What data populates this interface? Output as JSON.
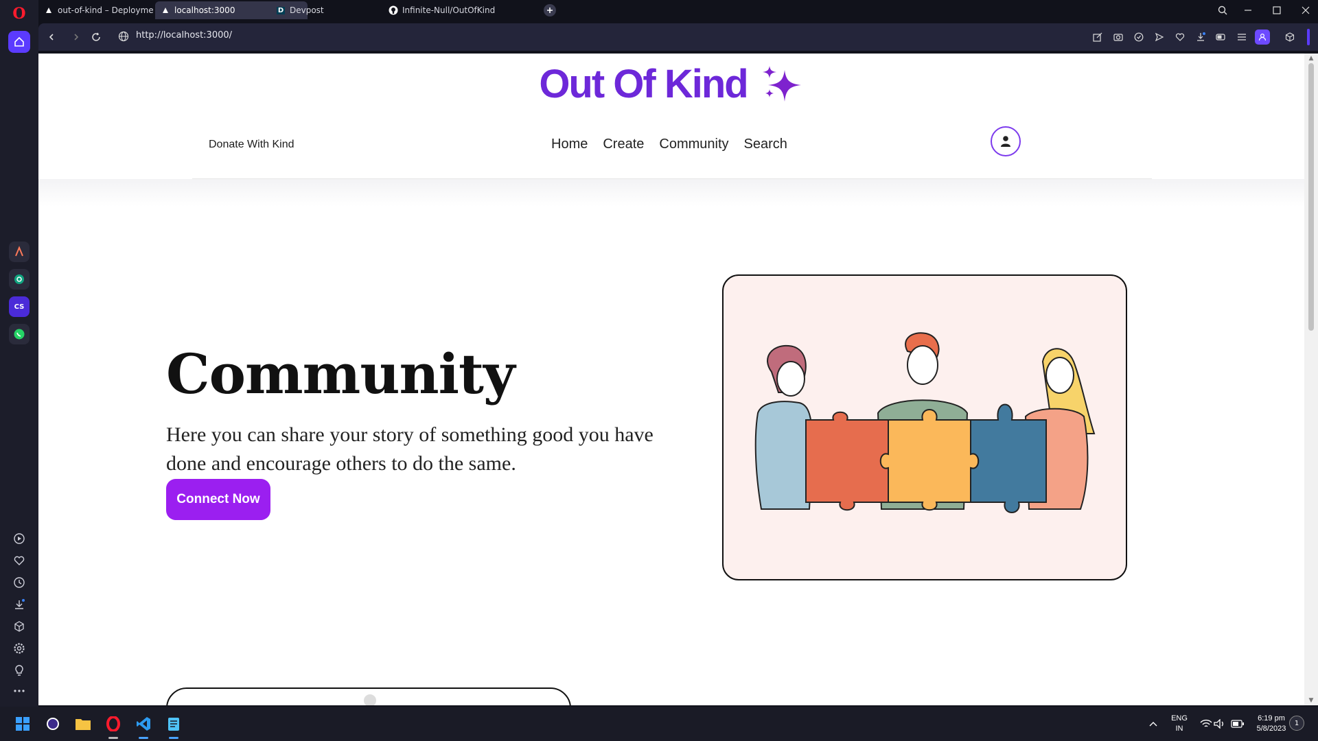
{
  "browser": {
    "tabs": [
      {
        "label": "out-of-kind – Deployment",
        "active": false
      },
      {
        "label": "localhost:3000",
        "active": true
      },
      {
        "label": "Devpost",
        "active": false
      },
      {
        "label": "Infinite-Null/OutOfKind",
        "active": false
      }
    ],
    "devpost_favicon": "D",
    "url": "http://localhost:3000/",
    "colors": {
      "accent": "#5b3bff",
      "chrome": "#24253a"
    }
  },
  "page": {
    "brand": "Out Of Kind",
    "brand_color": "#6d28d9",
    "nav": {
      "donate": "Donate With Kind",
      "links": [
        "Home",
        "Create",
        "Community",
        "Search"
      ]
    },
    "hero": {
      "title": "Community",
      "description": "Here you can share your story of something good you have done and encourage others to do the same.",
      "cta": "Connect Now",
      "cta_color": "#9b1ff0"
    }
  },
  "sidebar": {
    "apps": [
      "aria-icon",
      "chatgpt-icon",
      "chatsonic-icon",
      "whatsapp-icon"
    ],
    "app_labels": {
      "chatsonic": "CS"
    },
    "bottom": [
      "player-icon",
      "heart-icon",
      "history-icon",
      "downloads-icon",
      "extensions-icon",
      "settings-icon",
      "bulb-icon",
      "more-icon"
    ]
  },
  "taskbar": {
    "lang_top": "ENG",
    "lang_bottom": "IN",
    "time": "6:19 pm",
    "date": "5/8/2023",
    "notifications": "1"
  }
}
